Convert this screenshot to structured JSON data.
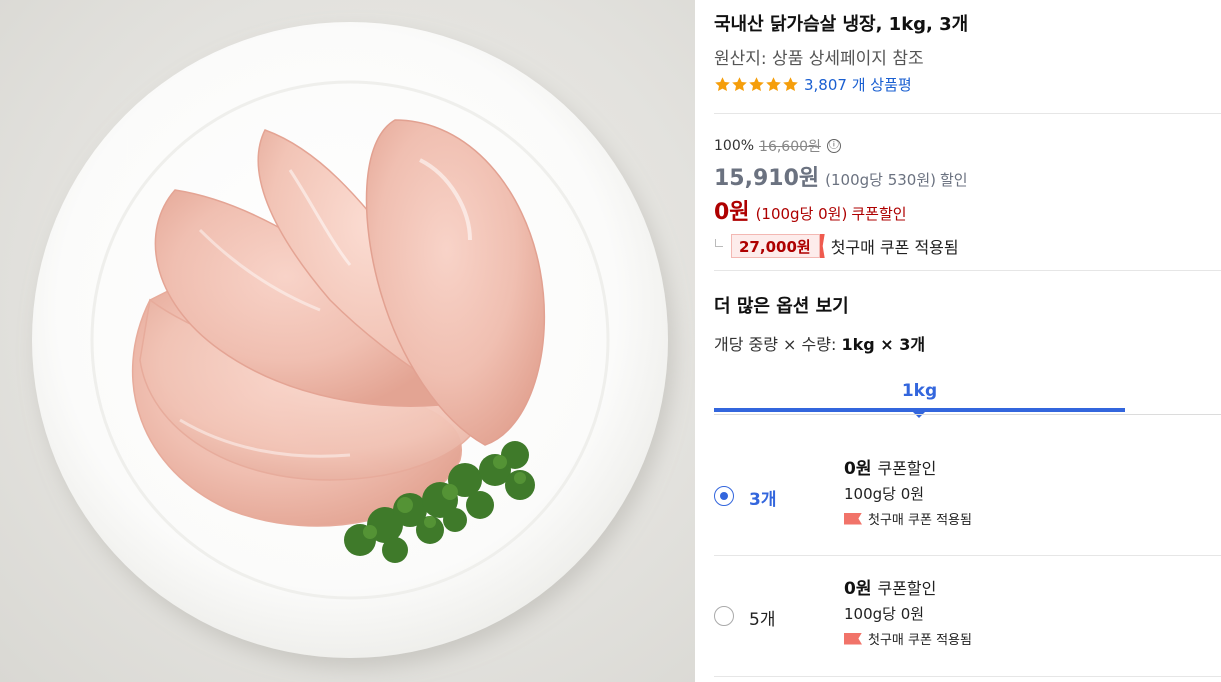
{
  "product": {
    "title": "국내산 닭가슴살 냉장, 1kg, 3개",
    "origin": "원산지: 상품 상세페이지 참조",
    "rating_stars": 5,
    "review_count": "3,807 개 상품평"
  },
  "price": {
    "discount_rate": "100%",
    "list_price": "16,600원",
    "info_icon": "ⓘ",
    "sale_price": "15,910원",
    "sale_unit_price": "(100g당 530원)",
    "sale_label": "할인",
    "coupon_price": "0원",
    "coupon_unit_price": "(100g당 0원)",
    "coupon_label": "쿠폰할인",
    "first_purchase_amount": "27,000원",
    "first_purchase_label": "첫구매 쿠폰 적용됨"
  },
  "options": {
    "section_title": "더 많은 옵션 보기",
    "qty_label": "개당 중량 × 수량:",
    "qty_value": "1kg × 3개",
    "tab_label": "1kg",
    "items": [
      {
        "name": "3개",
        "selected": true,
        "price": "0원",
        "price_label": "쿠폰할인",
        "unit_price": "100g당 0원",
        "coupon_note": "첫구매 쿠폰 적용됨"
      },
      {
        "name": "5개",
        "selected": false,
        "price": "0원",
        "price_label": "쿠폰할인",
        "unit_price": "100g당 0원",
        "coupon_note": "첫구매 쿠폰 적용됨"
      }
    ]
  },
  "colors": {
    "accent_blue": "#3366dd",
    "coupon_red": "#ae0000",
    "star_orange": "#f59e0b",
    "review_link": "#1a5fd1"
  },
  "icons": {
    "info": "info-circle-icon",
    "star": "star-icon",
    "coupon": "coupon-ticket-icon",
    "radio": "radio-button-icon",
    "caret": "caret-down-icon"
  }
}
